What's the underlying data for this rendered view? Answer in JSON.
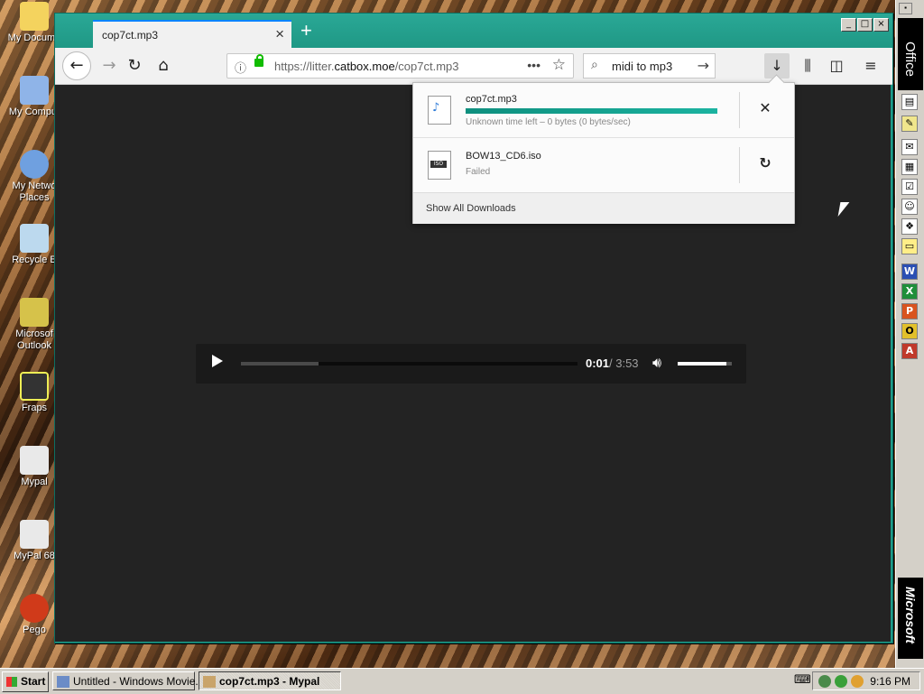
{
  "desktop": {
    "icons": [
      {
        "label": "My Docume",
        "color": "#f4d35e"
      },
      {
        "label": "My Comput",
        "color": "#8fb4e8"
      },
      {
        "label": "My Netwo Places",
        "color": "#6fa0e0"
      },
      {
        "label": "Recycle B",
        "color": "#bcd9ee"
      },
      {
        "label": "Microsof Outlook",
        "color": "#d6c24a"
      },
      {
        "label": "Fraps",
        "color": "#eeee55"
      },
      {
        "label": "Mypal",
        "color": "#e9e9e9"
      },
      {
        "label": "MyPal 68",
        "color": "#e9e9e9"
      },
      {
        "label": "Pego",
        "color": "#d03a1a"
      }
    ]
  },
  "browser": {
    "tab_title": "cop7ct.mp3",
    "new_tab_icon": "plus-icon",
    "url": {
      "host_prefix": "https://litter.",
      "host": "catbox.moe",
      "path": "/cop7ct.mp3"
    },
    "search_query": "midi to mp3",
    "accent_color": "#1d9c8a"
  },
  "player": {
    "current_time": "0:01",
    "total_time": "/ 3:53",
    "buffered_fraction": 0.23,
    "volume_fraction": 0.9
  },
  "downloads": {
    "items": [
      {
        "name": "cop7ct.mp3",
        "status": "Unknown time left – 0 bytes (0 bytes/sec)",
        "progress_fraction": 1.0,
        "action_icon": "close-icon",
        "action_glyph": "✕"
      },
      {
        "name": "BOW13_CD6.iso",
        "status": "Failed",
        "action_icon": "retry-icon",
        "action_glyph": "↻"
      }
    ],
    "show_all_label": "Show All Downloads"
  },
  "officebar": {
    "title": "Office",
    "logo": "Microsoft"
  },
  "taskbar": {
    "start_label": "Start",
    "tasks": [
      {
        "label": "Untitled - Windows Movie...",
        "active": false
      },
      {
        "label": "cop7ct.mp3 - Mypal",
        "active": true
      }
    ],
    "clock": "9:16 PM"
  }
}
